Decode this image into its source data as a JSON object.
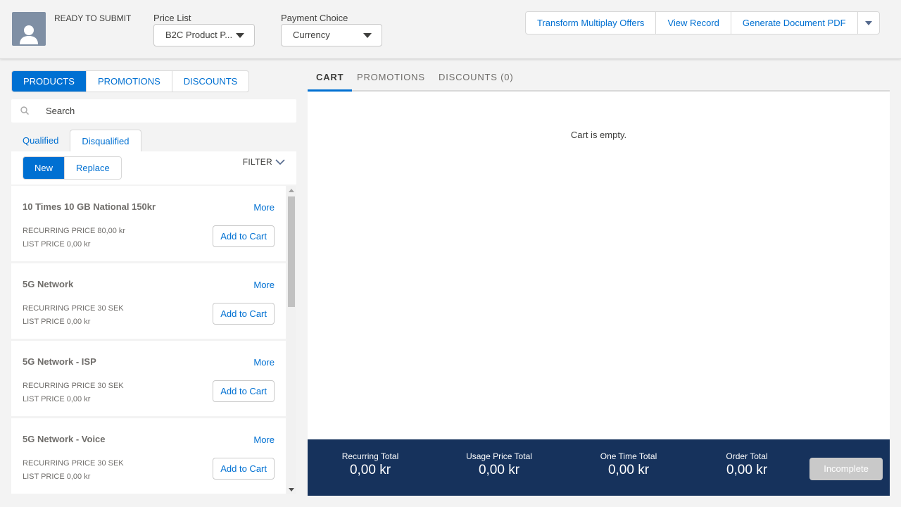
{
  "header": {
    "status": "READY TO SUBMIT",
    "price_list_label": "Price List",
    "price_list_value": "B2C Product P...",
    "payment_label": "Payment Choice",
    "payment_value": "Currency",
    "actions": [
      "Transform Multiplay Offers",
      "View Record",
      "Generate Document PDF"
    ]
  },
  "left": {
    "tabs": [
      "PRODUCTS",
      "PROMOTIONS",
      "DISCOUNTS"
    ],
    "active_tab": "PRODUCTS",
    "search_placeholder": "Search",
    "qual_tabs": [
      "Qualified",
      "Disqualified"
    ],
    "mode_buttons": [
      "New",
      "Replace"
    ],
    "filter_label": "FILTER",
    "products": [
      {
        "name": "10 Times 10 GB National 150kr",
        "more": "More",
        "recurring": "RECURRING PRICE 80,00 kr",
        "list": "LIST PRICE 0,00 kr",
        "add": "Add to Cart"
      },
      {
        "name": "5G Network",
        "more": "More",
        "recurring": "RECURRING PRICE 30 SEK",
        "list": "LIST PRICE 0,00 kr",
        "add": "Add to Cart"
      },
      {
        "name": "5G Network - ISP",
        "more": "More",
        "recurring": "RECURRING PRICE 30 SEK",
        "list": "LIST PRICE 0,00 kr",
        "add": "Add to Cart"
      },
      {
        "name": "5G Network - Voice",
        "more": "More",
        "recurring": "RECURRING PRICE 30 SEK",
        "list": "LIST PRICE 0,00 kr",
        "add": "Add to Cart"
      }
    ]
  },
  "right": {
    "tabs": [
      "CART",
      "PROMOTIONS",
      "DISCOUNTS (0)"
    ],
    "active_tab": "CART",
    "empty_message": "Cart is empty.",
    "totals": [
      {
        "label": "Recurring Total",
        "value": "0,00 kr"
      },
      {
        "label": "Usage Price Total",
        "value": "0,00 kr"
      },
      {
        "label": "One Time Total",
        "value": "0,00 kr"
      },
      {
        "label": "Order Total",
        "value": "0,00 kr"
      }
    ],
    "status_button": "Incomplete"
  },
  "colors": {
    "accent": "#0070d2",
    "totals_bar": "#16325c",
    "disabled_button": "#c9c9c9"
  }
}
